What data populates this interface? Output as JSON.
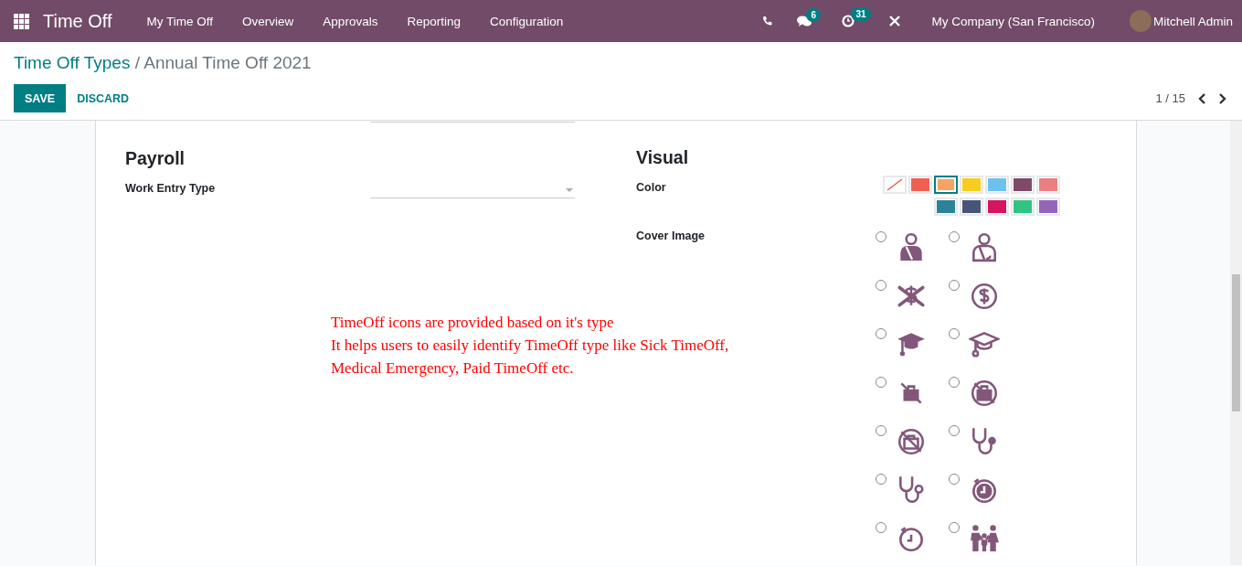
{
  "navbar": {
    "app_title": "Time Off",
    "menu": [
      "My Time Off",
      "Overview",
      "Approvals",
      "Reporting",
      "Configuration"
    ],
    "messages_badge": "6",
    "activities_badge": "31",
    "company": "My Company (San Francisco)",
    "user": "Mitchell Admin"
  },
  "breadcrumb": {
    "parent": "Time Off Types",
    "separator": "/",
    "current": "Annual Time Off 2021"
  },
  "buttons": {
    "save": "SAVE",
    "discard": "DISCARD"
  },
  "pager": {
    "value": "1 / 15"
  },
  "payroll": {
    "title": "Payroll",
    "fields": [
      {
        "label": "Work Entry Type"
      }
    ]
  },
  "visual": {
    "title": "Visual",
    "color_label": "Color",
    "colors": [
      {
        "kind": "none",
        "selected": false
      },
      {
        "kind": "swatch",
        "color": "#f06050",
        "selected": false
      },
      {
        "kind": "swatch",
        "color": "#f4a460",
        "selected": true
      },
      {
        "kind": "swatch",
        "color": "#f7cd1f",
        "selected": false
      },
      {
        "kind": "swatch",
        "color": "#6cc1ed",
        "selected": false
      },
      {
        "kind": "swatch",
        "color": "#814968",
        "selected": false
      },
      {
        "kind": "swatch",
        "color": "#eb7e7f",
        "selected": false
      },
      {
        "kind": "swatch",
        "color": "#2c8397",
        "selected": false
      },
      {
        "kind": "swatch",
        "color": "#475577",
        "selected": false
      },
      {
        "kind": "swatch",
        "color": "#d6145f",
        "selected": false
      },
      {
        "kind": "swatch",
        "color": "#30c381",
        "selected": false
      },
      {
        "kind": "swatch",
        "color": "#9365b8",
        "selected": false
      }
    ],
    "cover_label": "Cover Image",
    "cover_images": [
      {
        "kind": "sling-filled",
        "selected": false
      },
      {
        "kind": "sling-outline",
        "selected": false
      },
      {
        "kind": "dollar-crossed",
        "selected": false
      },
      {
        "kind": "dollar-circle",
        "selected": false
      },
      {
        "kind": "cap-filled",
        "selected": false
      },
      {
        "kind": "cap-outline",
        "selected": false
      },
      {
        "kind": "bag-crossed",
        "selected": false
      },
      {
        "kind": "bag-banned",
        "selected": false
      },
      {
        "kind": "bag-banned-outline",
        "selected": false
      },
      {
        "kind": "stethoscope-filled",
        "selected": false
      },
      {
        "kind": "stethoscope-outline",
        "selected": false
      },
      {
        "kind": "history-filled",
        "selected": false
      },
      {
        "kind": "history-outline",
        "selected": false
      },
      {
        "kind": "family",
        "selected": false
      }
    ]
  },
  "annotation": {
    "lines": [
      "TimeOff icons are provided based on it's type",
      "It helps users to easily identify TimeOff type like Sick TimeOff,",
      "Medical Emergency, Paid TimeOff etc."
    ]
  }
}
